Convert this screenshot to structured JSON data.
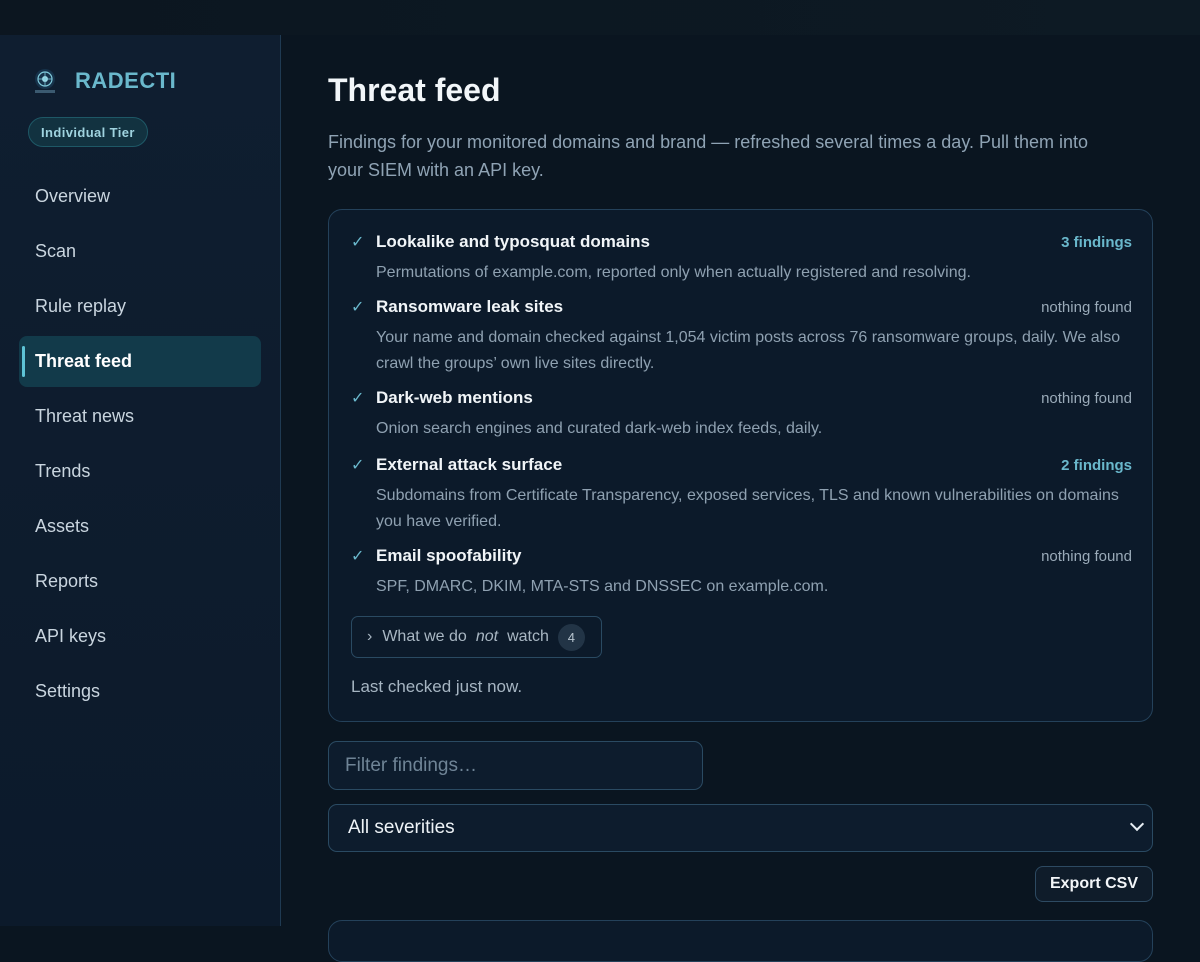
{
  "brand": {
    "name": "RADECTI",
    "tier": "Individual Tier"
  },
  "nav": [
    {
      "label": "Overview",
      "active": false
    },
    {
      "label": "Scan",
      "active": false
    },
    {
      "label": "Rule replay",
      "active": false
    },
    {
      "label": "Threat feed",
      "active": true
    },
    {
      "label": "Threat news",
      "active": false
    },
    {
      "label": "Trends",
      "active": false
    },
    {
      "label": "Assets",
      "active": false
    },
    {
      "label": "Reports",
      "active": false
    },
    {
      "label": "API keys",
      "active": false
    },
    {
      "label": "Settings",
      "active": false
    }
  ],
  "page": {
    "title": "Threat feed",
    "subtitle": "Findings for your monitored domains and brand — refreshed several times a day. Pull them into your SIEM with an API key."
  },
  "monitors": [
    {
      "title": "Lookalike and typosquat domains",
      "status": "3 findings",
      "has_findings": true,
      "description": "Permutations of example.com, reported only when actually registered and resolving."
    },
    {
      "title": "Ransomware leak sites",
      "status": "nothing found",
      "has_findings": false,
      "description": "Your name and domain checked against 1,054 victim posts across 76 ransomware groups, daily. We also crawl the groups’ own live sites directly."
    },
    {
      "title": "Dark-web mentions",
      "status": "nothing found",
      "has_findings": false,
      "description": "Onion search engines and curated dark-web index feeds, daily."
    },
    {
      "title": "External attack surface",
      "status": "2 findings",
      "has_findings": true,
      "description": "Subdomains from Certificate Transparency, exposed services, TLS and known vulnerabilities on domains you have verified."
    },
    {
      "title": "Email spoofability",
      "status": "nothing found",
      "has_findings": false,
      "description": "SPF, DMARC, DKIM, MTA-STS and DNSSEC on example.com."
    }
  ],
  "not_watch": {
    "prefix": "What we do",
    "emphasis": "not",
    "suffix": "watch",
    "count": "4"
  },
  "last_checked": "Last checked just now.",
  "filter": {
    "placeholder": "Filter findings…"
  },
  "severity": {
    "selected": "All severities"
  },
  "export_label": "Export CSV",
  "colors": {
    "accent": "#6ab8cc",
    "background": "#0a1520",
    "sidebar": "#0f1e30"
  }
}
